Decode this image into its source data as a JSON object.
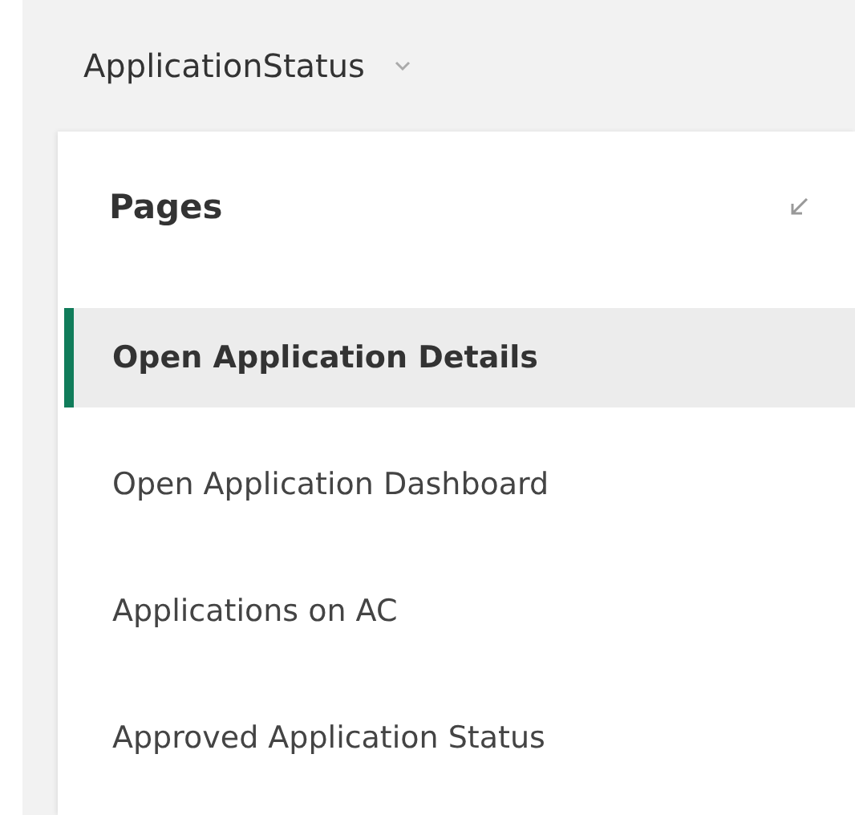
{
  "report": {
    "title": "ApplicationStatus"
  },
  "pages_pane": {
    "heading": "Pages",
    "items": [
      {
        "label": "Open Application Details",
        "selected": true
      },
      {
        "label": "Open Application Dashboard",
        "selected": false
      },
      {
        "label": "Applications on AC",
        "selected": false
      },
      {
        "label": "Approved Application Status",
        "selected": false
      }
    ]
  }
}
